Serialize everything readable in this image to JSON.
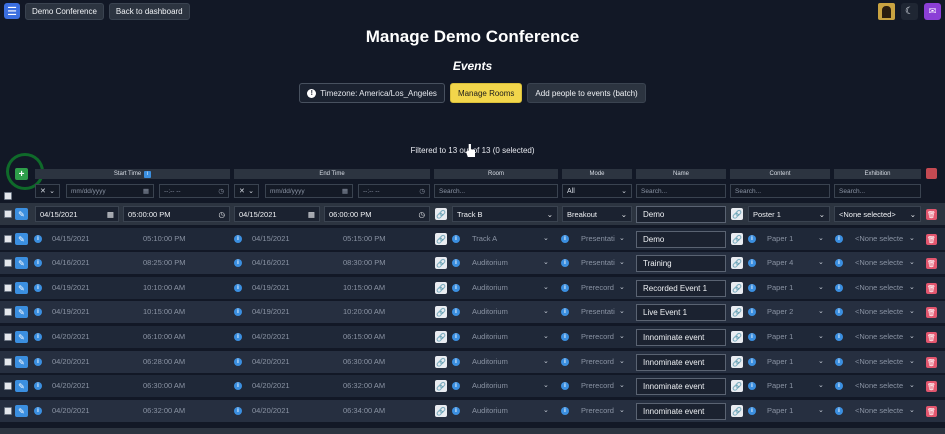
{
  "nav": {
    "menu_icon": "hamburger-icon",
    "conference_label": "Demo Conference",
    "dashboard_label": "Back to dashboard"
  },
  "page": {
    "title": "Manage Demo Conference",
    "subtitle": "Events"
  },
  "actions": {
    "timezone_label": "Timezone: America/Los_Angeles",
    "rooms_label": "Manage Rooms",
    "batch_label": "Add people to events (batch)"
  },
  "filter_status": "Filtered to 13 out of 13 (0 selected)",
  "columns": {
    "start": "Start Time",
    "end": "End Time",
    "room": "Room",
    "mode": "Mode",
    "name": "Name",
    "content": "Content",
    "exhibition": "Exhibition"
  },
  "filters": {
    "date_placeholder": "mm/dd/yyyy",
    "time_placeholder": "--:-- --",
    "search_placeholder": "Search...",
    "mode_value": "All"
  },
  "edit_row": {
    "start_date": "04/15/2021",
    "start_time": "05:00:00 PM",
    "end_date": "04/15/2021",
    "end_time": "06:00:00 PM",
    "room": "Track B",
    "mode": "Breakout",
    "name": "Demo",
    "content": "Poster 1",
    "exhibition": "<None selected>"
  },
  "rows": [
    {
      "start_date": "04/15/2021",
      "start_time": "05:10:00 PM",
      "end_date": "04/15/2021",
      "end_time": "05:15:00 PM",
      "room": "Track A",
      "mode": "Presentati",
      "name": "Demo",
      "content": "Paper 1",
      "exhibition": "<None selecte"
    },
    {
      "start_date": "04/16/2021",
      "start_time": "08:25:00 PM",
      "end_date": "04/16/2021",
      "end_time": "08:30:00 PM",
      "room": "Auditorium",
      "mode": "Presentati",
      "name": "Training",
      "content": "Paper 4",
      "exhibition": "<None selecte"
    },
    {
      "start_date": "04/19/2021",
      "start_time": "10:10:00 AM",
      "end_date": "04/19/2021",
      "end_time": "10:15:00 AM",
      "room": "Auditorium",
      "mode": "Prerecord",
      "name": "Recorded Event 1",
      "content": "Paper 1",
      "exhibition": "<None selecte"
    },
    {
      "start_date": "04/19/2021",
      "start_time": "10:15:00 AM",
      "end_date": "04/19/2021",
      "end_time": "10:20:00 AM",
      "room": "Auditorium",
      "mode": "Presentati",
      "name": "Live Event 1",
      "content": "Paper 2",
      "exhibition": "<None selecte"
    },
    {
      "start_date": "04/20/2021",
      "start_time": "06:10:00 AM",
      "end_date": "04/20/2021",
      "end_time": "06:15:00 AM",
      "room": "Auditorium",
      "mode": "Prerecord",
      "name": "Innominate event",
      "content": "Paper 1",
      "exhibition": "<None selecte"
    },
    {
      "start_date": "04/20/2021",
      "start_time": "06:28:00 AM",
      "end_date": "04/20/2021",
      "end_time": "06:30:00 AM",
      "room": "Auditorium",
      "mode": "Prerecord",
      "name": "Innominate event",
      "content": "Paper 1",
      "exhibition": "<None selecte"
    },
    {
      "start_date": "04/20/2021",
      "start_time": "06:30:00 AM",
      "end_date": "04/20/2021",
      "end_time": "06:32:00 AM",
      "room": "Auditorium",
      "mode": "Prerecord",
      "name": "Innominate event",
      "content": "Paper 1",
      "exhibition": "<None selecte"
    },
    {
      "start_date": "04/20/2021",
      "start_time": "06:32:00 AM",
      "end_date": "04/20/2021",
      "end_time": "06:34:00 AM",
      "room": "Auditorium",
      "mode": "Prerecord",
      "name": "Innominate event",
      "content": "Paper 1",
      "exhibition": "<None selecte"
    }
  ]
}
